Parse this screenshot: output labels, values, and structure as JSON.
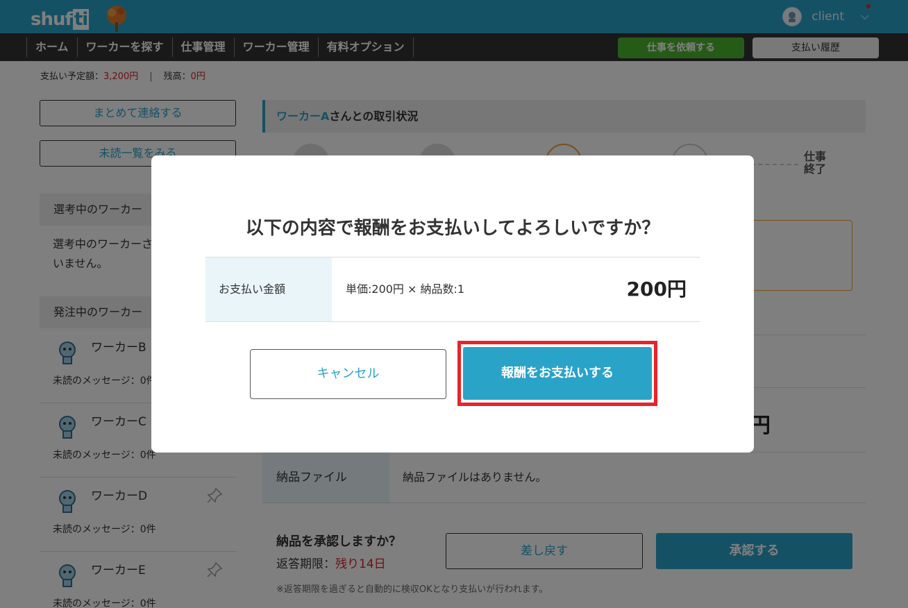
{
  "header": {
    "logo_text_a": "shuf",
    "logo_text_b": "ti",
    "username": "client"
  },
  "nav": {
    "items": [
      "ホーム",
      "ワーカーを探す",
      "仕事管理",
      "ワーカー管理",
      "有料オプション"
    ],
    "request_label": "仕事を依頼する",
    "history_label": "支払い履歴"
  },
  "payment_info": {
    "scheduled_label": "支払い予定額：",
    "scheduled_value": "3,200円",
    "separator": "|",
    "balance_label": "残高：",
    "balance_value": "0円"
  },
  "sidebar": {
    "contact_all_label": "まとめて連絡する",
    "unread_list_label": "未読一覧をみる",
    "selecting_heading": "選考中のワーカー",
    "selecting_empty_line1": "選考中のワーカーさ",
    "selecting_empty_line2": "いません。",
    "ordering_heading": "発注中のワーカー",
    "workers": [
      {
        "name": "ワーカーB",
        "messages": "未読のメッセージ：0件"
      },
      {
        "name": "ワーカーC",
        "messages": "未読のメッセージ：0件"
      },
      {
        "name": "ワーカーD",
        "messages": "未読のメッセージ：0件"
      },
      {
        "name": "ワーカーE",
        "messages": "未読のメッセージ：0件"
      }
    ]
  },
  "main": {
    "title_highlight": "ワーカーA",
    "title_rest": "さんとの取引状況",
    "step_final_line1": "仕事",
    "step_final_line2": "終了",
    "amount_partial": "円",
    "file_label": "納品ファイル",
    "file_value": "納品ファイルはありません。",
    "confirm_question": "納品を承認しますか？",
    "deadline_label": "返答期限：",
    "deadline_value": "残り14日",
    "return_label": "差し戻す",
    "approve_label": "承認する",
    "note": "※返答期限を過ぎると自動的に検収OKとなり支払いが行われます。"
  },
  "modal": {
    "title": "以下の内容で報酬をお支払いしてよろしいですか？",
    "amount_label": "お支払い金額",
    "amount_detail": "単価:200円 × 納品数:1",
    "amount_total": "200円",
    "cancel_label": "キャンセル",
    "pay_label": "報酬をお支払いする"
  },
  "colors": {
    "brand": "#2aa3c9",
    "request_green": "#4cb62e",
    "alert_red": "#e8232c"
  }
}
